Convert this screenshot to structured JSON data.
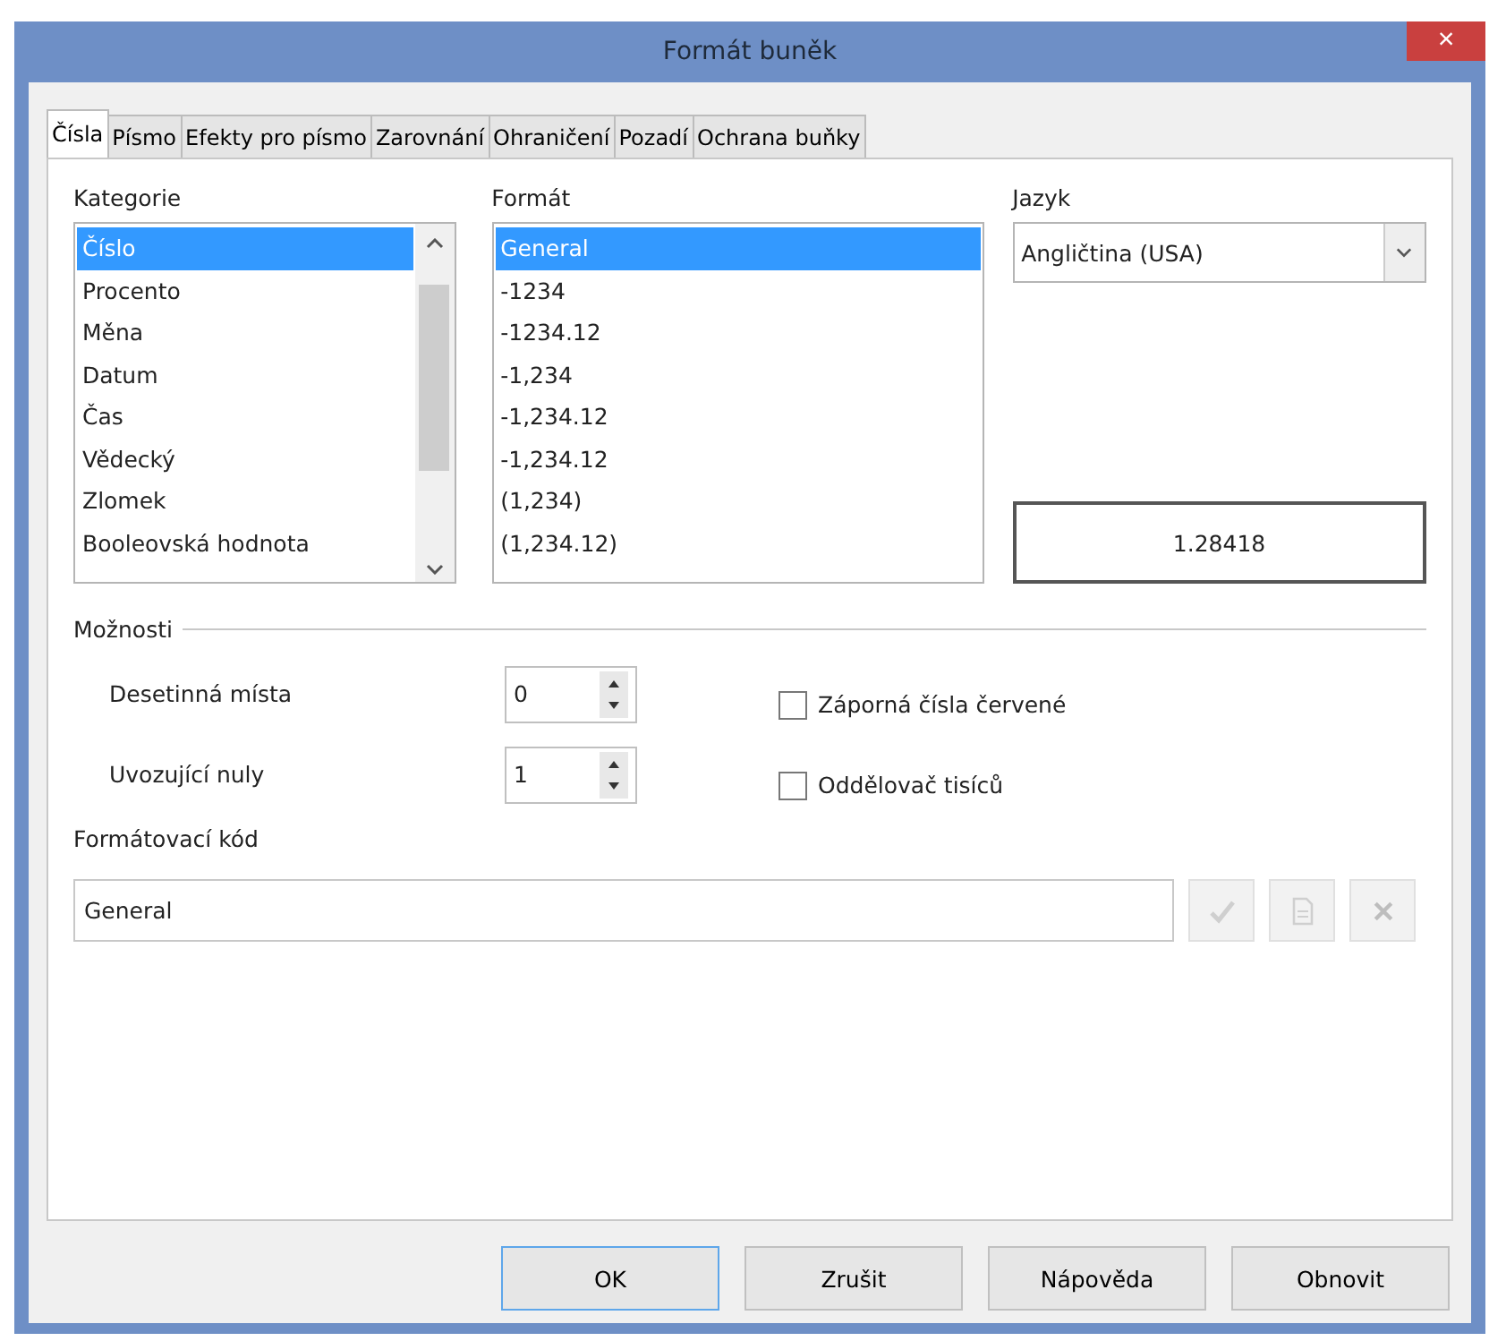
{
  "window": {
    "title": "Formát buněk",
    "close": "×"
  },
  "tabs": [
    {
      "label": "Čísla",
      "selected": true
    },
    {
      "label": "Písmo",
      "selected": false
    },
    {
      "label": "Efekty pro písmo",
      "selected": false
    },
    {
      "label": "Zarovnání",
      "selected": false
    },
    {
      "label": "Ohraničení",
      "selected": false
    },
    {
      "label": "Pozadí",
      "selected": false
    },
    {
      "label": "Ochrana buňky",
      "selected": false
    }
  ],
  "category": {
    "label": "Kategorie",
    "items": [
      {
        "label": "Číslo",
        "selected": true
      },
      {
        "label": "Procento",
        "selected": false
      },
      {
        "label": "Měna",
        "selected": false
      },
      {
        "label": "Datum",
        "selected": false
      },
      {
        "label": "Čas",
        "selected": false
      },
      {
        "label": "Vědecký",
        "selected": false
      },
      {
        "label": "Zlomek",
        "selected": false
      },
      {
        "label": "Booleovská hodnota",
        "selected": false
      }
    ]
  },
  "format": {
    "label": "Formát",
    "items": [
      {
        "label": "General",
        "selected": true
      },
      {
        "label": "-1234",
        "selected": false
      },
      {
        "label": "-1234.12",
        "selected": false
      },
      {
        "label": "-1,234",
        "selected": false
      },
      {
        "label": "-1,234.12",
        "selected": false
      },
      {
        "label": "-1,234.12",
        "selected": false
      },
      {
        "label": "(1,234)",
        "selected": false
      },
      {
        "label": "(1,234.12)",
        "selected": false
      }
    ]
  },
  "language": {
    "label": "Jazyk",
    "value": "Angličtina (USA)"
  },
  "preview": "1.28418",
  "options": {
    "title": "Možnosti",
    "spins": [
      {
        "label": "Desetinná místa",
        "value": "0"
      },
      {
        "label": "Uvozující nuly",
        "value": "1"
      }
    ],
    "checks": [
      {
        "label": "Záporná čísla červené",
        "checked": false
      },
      {
        "label": "Oddělovač tisíců",
        "checked": false
      }
    ]
  },
  "format_code": {
    "label": "Formátovací kód",
    "value": "General"
  },
  "buttons": [
    {
      "label": "OK",
      "default": true
    },
    {
      "label": "Zrušit",
      "default": false
    },
    {
      "label": "Nápověda",
      "default": false
    },
    {
      "label": "Obnovit",
      "default": false
    }
  ]
}
